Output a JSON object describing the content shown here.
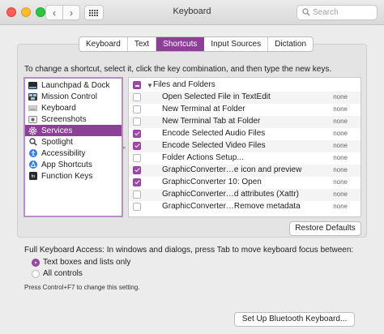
{
  "window": {
    "title": "Keyboard"
  },
  "search": {
    "placeholder": "Search"
  },
  "tabs": [
    {
      "label": "Keyboard",
      "active": false
    },
    {
      "label": "Text",
      "active": false
    },
    {
      "label": "Shortcuts",
      "active": true
    },
    {
      "label": "Input Sources",
      "active": false
    },
    {
      "label": "Dictation",
      "active": false
    }
  ],
  "instructions": "To change a shortcut, select it, click the key combination, and then type the new keys.",
  "categories": [
    {
      "label": "Launchpad & Dock",
      "icon": "launchpad-icon",
      "selected": false
    },
    {
      "label": "Mission Control",
      "icon": "mission-control-icon",
      "selected": false
    },
    {
      "label": "Keyboard",
      "icon": "keyboard-icon",
      "selected": false
    },
    {
      "label": "Screenshots",
      "icon": "screenshot-icon",
      "selected": false
    },
    {
      "label": "Services",
      "icon": "gear-icon",
      "selected": true
    },
    {
      "label": "Spotlight",
      "icon": "spotlight-icon",
      "selected": false
    },
    {
      "label": "Accessibility",
      "icon": "accessibility-icon",
      "selected": false
    },
    {
      "label": "App Shortcuts",
      "icon": "app-shortcuts-icon",
      "selected": false
    },
    {
      "label": "Function Keys",
      "icon": "fn-key-icon",
      "selected": false
    }
  ],
  "group": {
    "label": "Files and Folders",
    "state": "mixed"
  },
  "shortcuts": [
    {
      "name": "Open Selected File in TextEdit",
      "checked": false,
      "key": "none"
    },
    {
      "name": "New Terminal at Folder",
      "checked": false,
      "key": "none"
    },
    {
      "name": "New Terminal Tab at Folder",
      "checked": false,
      "key": "none"
    },
    {
      "name": "Encode Selected Audio Files",
      "checked": true,
      "key": "none"
    },
    {
      "name": "Encode Selected Video Files",
      "checked": true,
      "key": "none"
    },
    {
      "name": "Folder Actions Setup...",
      "checked": false,
      "key": "none"
    },
    {
      "name": "GraphicConverter…e icon and preview",
      "checked": true,
      "key": "none"
    },
    {
      "name": "GraphicConverter 10: Open",
      "checked": true,
      "key": "none"
    },
    {
      "name": "GraphicConverter…d attributes (Xattr)",
      "checked": false,
      "key": "none"
    },
    {
      "name": "GraphicConverter…Remove metadata",
      "checked": false,
      "key": "none"
    }
  ],
  "restore_button": "Restore Defaults",
  "full_keyboard_access": {
    "label": "Full Keyboard Access: In windows and dialogs, press Tab to move keyboard focus between:",
    "options": [
      {
        "label": "Text boxes and lists only",
        "selected": true
      },
      {
        "label": "All controls",
        "selected": false
      }
    ],
    "hint": "Press Control+F7 to change this setting."
  },
  "bluetooth_button": "Set Up Bluetooth Keyboard...",
  "colors": {
    "accent": "#8e3f98",
    "checkbox": "#9d4aa8"
  }
}
